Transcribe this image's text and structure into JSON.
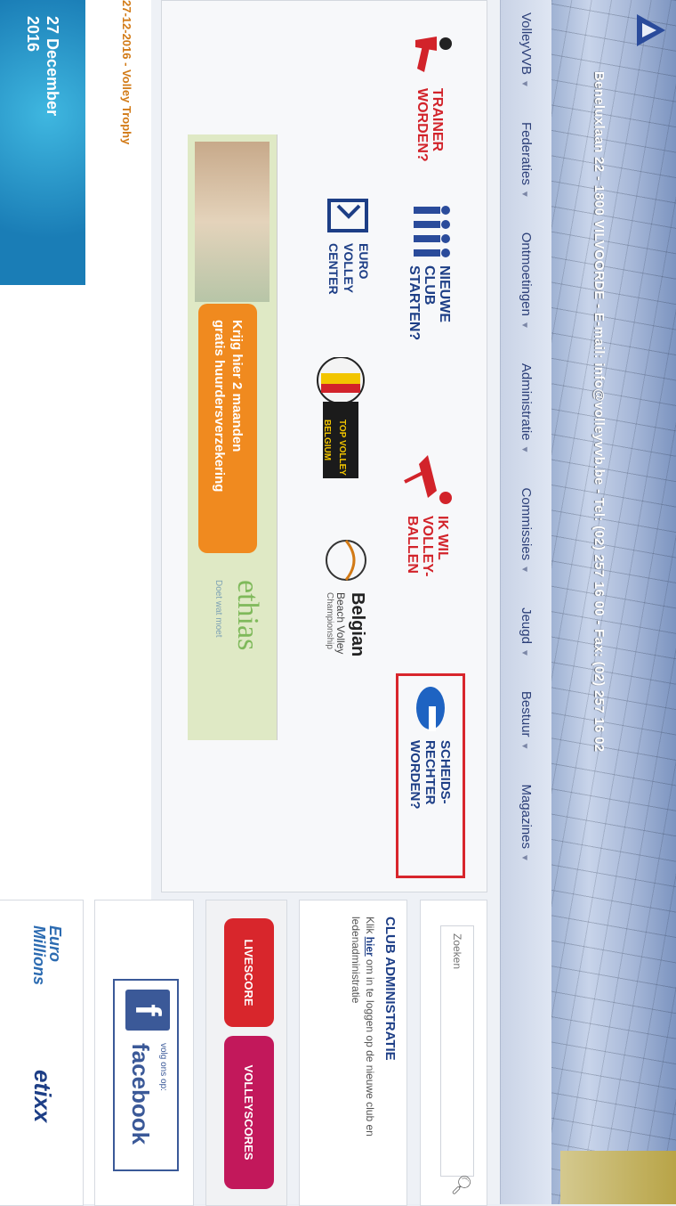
{
  "header": {
    "address": "Beneluxlaan 22 - 1800 VILVOORDE - E-mail: info@volleyvvb.be - Tel: (02) 257 16 00 - Fax: (02) 257 16 02"
  },
  "nav": [
    {
      "label": "VolleyVVB"
    },
    {
      "label": "Federaties"
    },
    {
      "label": "Ontmoetingen"
    },
    {
      "label": "Administratie"
    },
    {
      "label": "Commissies"
    },
    {
      "label": "Jeugd"
    },
    {
      "label": "Bestuur"
    },
    {
      "label": "Magazines"
    }
  ],
  "tiles": {
    "trainer": "TRAINER WORDEN?",
    "euro": "EURO VOLLEY CENTER",
    "club": "NIEUWE CLUB STARTEN?",
    "top_volley": "TOP VOLLEY BELGIUM",
    "wil": "IK WIL VOLLEY-BALLEN",
    "belgian": "Belgian",
    "belgian_sub": "Beach Volley",
    "belgian_sub2": "Championship",
    "scheids": "SCHEIDS-RECHTER WORDEN?"
  },
  "banner": {
    "line1": "Krijg hier 2 maanden",
    "line2": "gratis huurdersverzekering",
    "brand": "ethias",
    "brand_sub": "Doet wat moet"
  },
  "news": {
    "date_title": "27-12-2016 - Volley Trophy",
    "event_line1": "27 December",
    "event_line2": "2016"
  },
  "sidebar": {
    "search_placeholder": "Zoeken",
    "club_title": "CLUB ADMINISTRATIE",
    "club_text_pre": "Klik ",
    "club_link": "hier",
    "club_text_post": " om in te loggen op de nieuwe club en ledenadministratie",
    "livescore": "LIVESCORE",
    "volleyscores": "VOLLEYSCORES",
    "fb_follow": "volg ons op:",
    "fb_brand": "facebook",
    "sponsor1_line1": "Euro",
    "sponsor1_line2": "Millions",
    "sponsor2": "etixx"
  },
  "colors": {
    "accent_blue": "#1d3e86",
    "accent_red": "#d2232a",
    "volleyscores": "#c2185b",
    "facebook": "#3b5998"
  }
}
